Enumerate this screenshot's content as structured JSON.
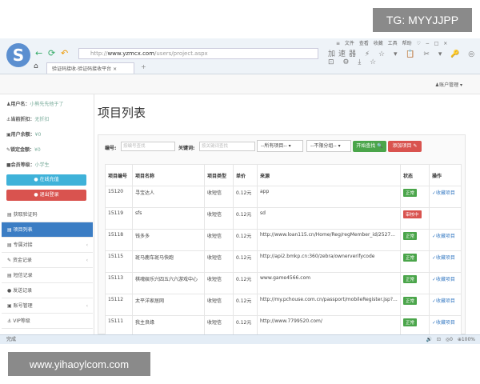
{
  "watermarks": {
    "top": "TG: MYYJJPP",
    "bottom": "www.yihaoylcom.com"
  },
  "browser": {
    "logo": "S",
    "url_prefix": "http://",
    "url_domain": "www.yzmcx.com",
    "url_path": "/users/project.aspx",
    "menu": "≡ 文件 查看 收藏 工具 帮助 ♡ − □ ×",
    "tools": "加速器 ⚡ ☆ ▾ 📋 ✂ ▾ 🔑 ◎ ⊡ ⚙ ⤓ ☆",
    "tab_title": "验证码接收-验证码接收平台",
    "tab_close": "×",
    "new_tab": "+",
    "home": "⌂",
    "back": "←",
    "refresh": "⟳",
    "undo": "↶"
  },
  "header": {
    "account_menu": "♟账户管理 ▾"
  },
  "sidebar": {
    "info": [
      {
        "label": "♟用户名：",
        "value": "小熊先先他于了"
      },
      {
        "label": "⚓当前折扣：",
        "value": "无折扣"
      },
      {
        "label": "▣用户余额：",
        "value": "¥0"
      },
      {
        "label": "✎锁定金额：",
        "value": "¥0"
      },
      {
        "label": "■会员等级：",
        "value": "小学生"
      }
    ],
    "online_recharge": "● 在线充值",
    "logout": "● 退出登录",
    "items": [
      {
        "label": "▤ 获取验证码",
        "active": false,
        "arrow": ""
      },
      {
        "label": "▤ 项目列表",
        "active": true,
        "arrow": ""
      },
      {
        "label": "▤ 专属对接",
        "active": false,
        "arrow": "‹"
      },
      {
        "label": "✎ 资金记录",
        "active": false,
        "arrow": "‹"
      },
      {
        "label": "▤ 短信记录",
        "active": false,
        "arrow": ""
      },
      {
        "label": "● 发送记录",
        "active": false,
        "arrow": ""
      },
      {
        "label": "▣ 账号管理",
        "active": false,
        "arrow": "‹"
      },
      {
        "label": "⚓ VIP等级",
        "active": false,
        "arrow": ""
      }
    ]
  },
  "main": {
    "title": "项目列表",
    "filter": {
      "id_label": "编号:",
      "id_placeholder": "按编号查找",
      "kw_label": "关键词:",
      "kw_placeholder": "按关键词查找",
      "project_select": "--所有项目--  ▾",
      "type_select": "--不限分组--  ▾",
      "search_button": "开始查找 🔍",
      "add_button": "添加项目 ✎"
    },
    "columns": [
      "项目编号",
      "项目名称",
      "项目类型",
      "单价",
      "来源",
      "状态",
      "操作"
    ],
    "rows": [
      {
        "id": "15120",
        "name": "寻宝达人",
        "type": "收短信",
        "price": "0.12元",
        "source": "app",
        "status": "正常",
        "op": "✓收藏项目"
      },
      {
        "id": "15119",
        "name": "sfs",
        "type": "收短信",
        "price": "0.12元",
        "source": "sd",
        "status": "审核中",
        "op": ""
      },
      {
        "id": "15118",
        "name": "钱多多",
        "type": "收短信",
        "price": "0.12元",
        "source": "http://www.loan115.cn/Home/Reg/regMember_id/2527...",
        "status": "正常",
        "op": "✓收藏项目"
      },
      {
        "id": "15115",
        "name": "斑马鹿车斑马快跑",
        "type": "收短信",
        "price": "0.12元",
        "source": "http://api2.bmkp.cn:360/zebra/ownerverifycode",
        "status": "正常",
        "op": "✓收藏项目"
      },
      {
        "id": "15113",
        "name": "棋魂娱乐兴四五六六游戏中心",
        "type": "收短信",
        "price": "0.12元",
        "source": "www.game4566.com",
        "status": "正常",
        "op": "✓收藏项目"
      },
      {
        "id": "15112",
        "name": "太平洋家居网",
        "type": "收短信",
        "price": "0.12元",
        "source": "http://my.pchouse.com.cn/passport/mobileRegister.jsp?...",
        "status": "正常",
        "op": "✓收藏项目"
      },
      {
        "id": "15111",
        "name": "我主良缘",
        "type": "收短信",
        "price": "0.12元",
        "source": "http://www.7799520.com/",
        "status": "正常",
        "op": "✓收藏项目"
      }
    ]
  },
  "statusbar": {
    "left": "完成",
    "right": "🔊 ⊡ ◎0 ⊕100%"
  },
  "colors": {
    "ok": "#4aa54a",
    "pending": "#d9534f",
    "primary": "#3b7dc4",
    "info": "#3fb2d9"
  }
}
